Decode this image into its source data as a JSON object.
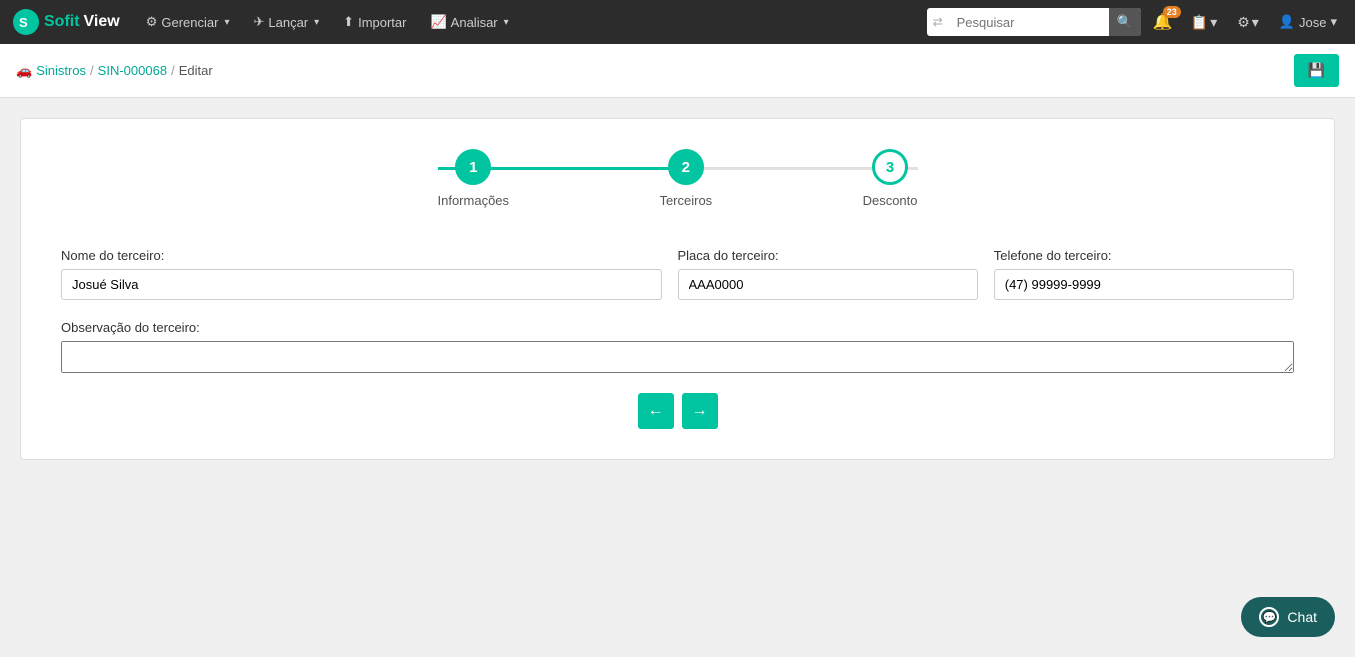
{
  "brand": {
    "sofit": "Sofit",
    "view": "View"
  },
  "navbar": {
    "items": [
      {
        "id": "gerenciar",
        "label": "Gerenciar",
        "icon": "⚙",
        "hasDropdown": true
      },
      {
        "id": "lancar",
        "label": "Lançar",
        "icon": "✈",
        "hasDropdown": true
      },
      {
        "id": "importar",
        "label": "Importar",
        "icon": "⬆",
        "hasDropdown": false
      },
      {
        "id": "analisar",
        "label": "Analisar",
        "icon": "📈",
        "hasDropdown": true
      }
    ],
    "search_placeholder": "Pesquisar",
    "notification_count": "23",
    "user_name": "Jose"
  },
  "breadcrumb": {
    "car_icon": "🚗",
    "sinistros_label": "Sinistros",
    "sin_label": "SIN-000068",
    "current": "Editar"
  },
  "toolbar": {
    "save_icon": "💾"
  },
  "stepper": {
    "steps": [
      {
        "number": "1",
        "label": "Informações",
        "state": "active"
      },
      {
        "number": "2",
        "label": "Terceiros",
        "state": "current"
      },
      {
        "number": "3",
        "label": "Desconto",
        "state": "inactive"
      }
    ]
  },
  "form": {
    "nome_label": "Nome do terceiro:",
    "nome_value": "Josué Silva",
    "placa_label": "Placa do terceiro:",
    "placa_value": "AAA0000",
    "telefone_label": "Telefone do terceiro:",
    "telefone_value": "(47) 99999-9999",
    "obs_label": "Observação do terceiro:",
    "obs_value": ""
  },
  "nav_buttons": {
    "back": "←",
    "forward": "→"
  },
  "chat": {
    "label": "Chat"
  }
}
